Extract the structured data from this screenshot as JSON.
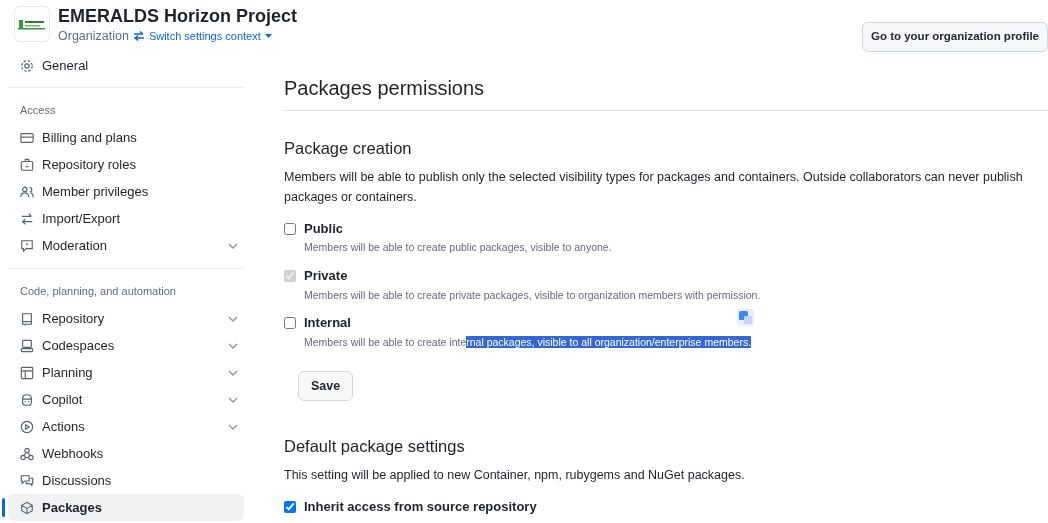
{
  "org": {
    "name": "EMERALDS Horizon Project",
    "type": "Organization",
    "switch_link": "Switch settings context"
  },
  "profile_button": "Go to your organization profile",
  "sidebar": [
    {
      "items": [
        {
          "label": "General",
          "collapsible": false,
          "selected": false
        }
      ]
    },
    {
      "heading": "Access",
      "items": [
        {
          "label": "Billing and plans",
          "collapsible": false,
          "selected": false
        },
        {
          "label": "Repository roles",
          "collapsible": false,
          "selected": false
        },
        {
          "label": "Member privileges",
          "collapsible": false,
          "selected": false
        },
        {
          "label": "Import/Export",
          "collapsible": false,
          "selected": false
        },
        {
          "label": "Moderation",
          "collapsible": true,
          "selected": false
        }
      ]
    },
    {
      "heading": "Code, planning, and automation",
      "items": [
        {
          "label": "Repository",
          "collapsible": true,
          "selected": false
        },
        {
          "label": "Codespaces",
          "collapsible": true,
          "selected": false
        },
        {
          "label": "Planning",
          "collapsible": true,
          "selected": false
        },
        {
          "label": "Copilot",
          "collapsible": true,
          "selected": false
        },
        {
          "label": "Actions",
          "collapsible": true,
          "selected": false
        },
        {
          "label": "Webhooks",
          "collapsible": false,
          "selected": false
        },
        {
          "label": "Discussions",
          "collapsible": false,
          "selected": false
        },
        {
          "label": "Packages",
          "collapsible": false,
          "selected": true
        }
      ]
    }
  ],
  "page_title": "Packages permissions",
  "creation": {
    "title": "Package creation",
    "description": "Members will be able to publish only the selected visibility types for packages and containers. Outside collaborators can never publish packages or containers.",
    "options": [
      {
        "label": "Public",
        "checked": false,
        "disabled": false,
        "description": [
          {
            "text": "Members will be able to create public packages, visible to anyone.",
            "highlighted": false
          }
        ]
      },
      {
        "label": "Private",
        "checked": true,
        "disabled": true,
        "description": [
          {
            "text": "Members will be able to create private packages, visible to organization members with permission.",
            "highlighted": false
          }
        ]
      },
      {
        "label": "Internal",
        "checked": false,
        "disabled": false,
        "description": [
          {
            "text": "Members will be able to create inte",
            "highlighted": false
          },
          {
            "text": "rnal packages, visible to all organization/enterprise members.",
            "highlighted": true
          }
        ]
      }
    ],
    "save_button": "Save"
  },
  "defaults": {
    "title": "Default package settings",
    "description": "This setting will be applied to new Container, npm, rubygems and NuGet packages.",
    "options": [
      {
        "label": "Inherit access from source repository",
        "checked": true,
        "disabled": false
      }
    ]
  }
}
